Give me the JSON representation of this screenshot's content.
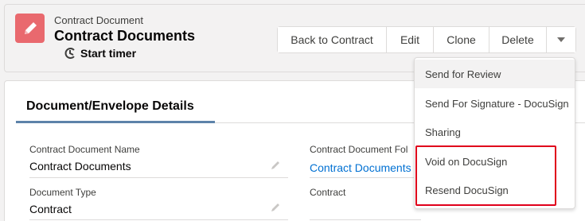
{
  "header": {
    "object_type": "Contract Document",
    "record_title": "Contract Documents",
    "timer_label": "Start timer",
    "buttons": {
      "back": "Back to Contract",
      "edit": "Edit",
      "clone": "Clone",
      "delete": "Delete"
    },
    "icon_color": "#e9696e"
  },
  "section": {
    "title": "Document/Envelope Details"
  },
  "fields": [
    {
      "label": "Contract Document Name",
      "value": "Contract Documents"
    },
    {
      "label": "Document Type",
      "value": "Contract"
    },
    {
      "label": "Contract Document Fol",
      "value": "Contract Documents"
    },
    {
      "label": "Contract",
      "value": ""
    }
  ],
  "menu": {
    "items": [
      {
        "label": "Send for Review"
      },
      {
        "label": "Send For Signature - DocuSign"
      },
      {
        "label": "Sharing"
      },
      {
        "label": "Void on DocuSign"
      },
      {
        "label": "Resend DocuSign"
      }
    ],
    "highlight_color": "#e0001b"
  }
}
